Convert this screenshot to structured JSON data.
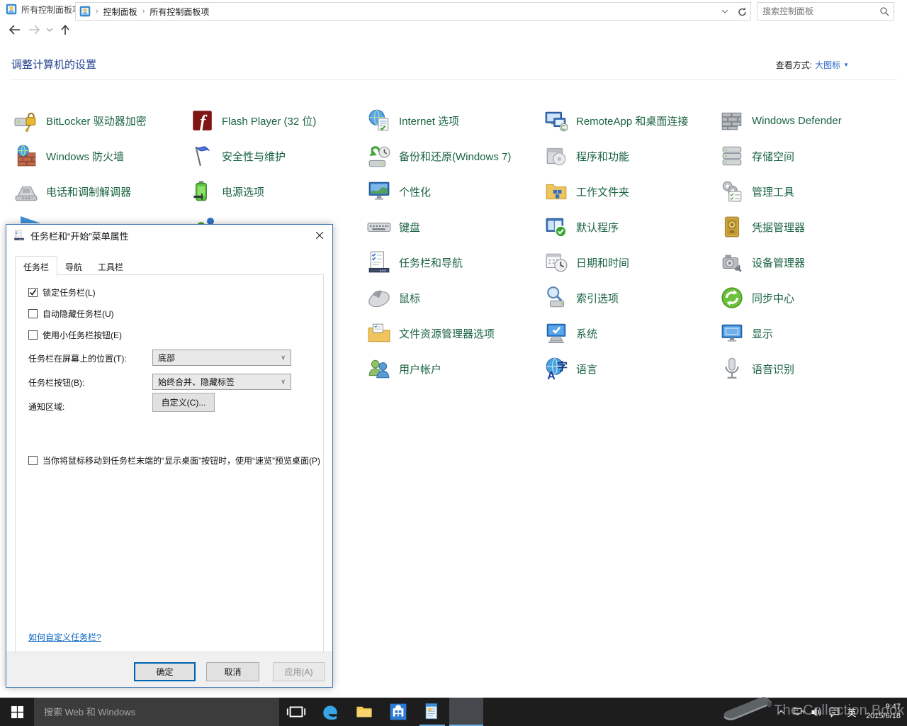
{
  "colors": {
    "accent": "#0078d7",
    "item_link": "#1a6340",
    "header_title": "#23418f",
    "link": "#0563c1",
    "taskbar_underline": "#6aaede"
  },
  "window": {
    "title": "所有控制面板项"
  },
  "toolbar": {
    "breadcrumb": [
      "控制面板",
      "所有控制面板项"
    ],
    "search_placeholder": "搜索控制面板"
  },
  "header": {
    "title": "调整计算机的设置",
    "view_label": "查看方式:",
    "view_value": "大图标"
  },
  "grid": {
    "items": [
      {
        "label": "BitLocker 驱动器加密",
        "icon": "bitlocker",
        "col": 0,
        "row": 0
      },
      {
        "label": "Windows 防火墙",
        "icon": "firewall",
        "col": 0,
        "row": 1
      },
      {
        "label": "电话和调制解调器",
        "icon": "phone",
        "col": 0,
        "row": 2
      },
      {
        "label": "Flash Player (32 位)",
        "icon": "flash",
        "col": 1,
        "row": 0
      },
      {
        "label": "安全性与维护",
        "icon": "security-flag",
        "col": 1,
        "row": 1
      },
      {
        "label": "电源选项",
        "icon": "power",
        "col": 1,
        "row": 2
      },
      {
        "label": "Internet 选项",
        "icon": "internet",
        "col": 2,
        "row": 0
      },
      {
        "label": "备份和还原(Windows 7)",
        "icon": "backup",
        "col": 2,
        "row": 1
      },
      {
        "label": "个性化",
        "icon": "personalization",
        "col": 2,
        "row": 2
      },
      {
        "label": "键盘",
        "icon": "keyboard",
        "col": 2,
        "row": 3
      },
      {
        "label": "任务栏和导航",
        "icon": "taskbar-nav",
        "col": 2,
        "row": 4
      },
      {
        "label": "鼠标",
        "icon": "mouse",
        "col": 2,
        "row": 5
      },
      {
        "label": "文件资源管理器选项",
        "icon": "explorer-options",
        "col": 2,
        "row": 6
      },
      {
        "label": "用户帐户",
        "icon": "user-accounts",
        "col": 2,
        "row": 7
      },
      {
        "label": "RemoteApp 和桌面连接",
        "icon": "remoteapp",
        "col": 3,
        "row": 0
      },
      {
        "label": "程序和功能",
        "icon": "programs",
        "col": 3,
        "row": 1
      },
      {
        "label": "工作文件夹",
        "icon": "work-folders",
        "col": 3,
        "row": 2
      },
      {
        "label": "默认程序",
        "icon": "default-programs",
        "col": 3,
        "row": 3
      },
      {
        "label": "日期和时间",
        "icon": "datetime",
        "col": 3,
        "row": 4
      },
      {
        "label": "索引选项",
        "icon": "indexing",
        "col": 3,
        "row": 5
      },
      {
        "label": "系统",
        "icon": "system",
        "col": 3,
        "row": 6
      },
      {
        "label": "语言",
        "icon": "language",
        "col": 3,
        "row": 7
      },
      {
        "label": "Windows Defender",
        "icon": "defender",
        "col": 4,
        "row": 0
      },
      {
        "label": "存储空间",
        "icon": "storage",
        "col": 4,
        "row": 1
      },
      {
        "label": "管理工具",
        "icon": "admin-tools",
        "col": 4,
        "row": 2
      },
      {
        "label": "凭据管理器",
        "icon": "credentials",
        "col": 4,
        "row": 3
      },
      {
        "label": "设备管理器",
        "icon": "device-manager",
        "col": 4,
        "row": 4
      },
      {
        "label": "同步中心",
        "icon": "sync",
        "col": 4,
        "row": 5
      },
      {
        "label": "显示",
        "icon": "display",
        "col": 4,
        "row": 6
      },
      {
        "label": "语音识别",
        "icon": "speech",
        "col": 4,
        "row": 7
      }
    ]
  },
  "dialog": {
    "title": "任务栏和“开始”菜单属性",
    "tabs": [
      "任务栏",
      "导航",
      "工具栏"
    ],
    "active_tab_index": 0,
    "checkboxes": [
      {
        "label": "锁定任务栏(L)",
        "checked": true
      },
      {
        "label": "自动隐藏任务栏(U)",
        "checked": false
      },
      {
        "label": "使用小任务栏按钮(E)",
        "checked": false
      }
    ],
    "fields": [
      {
        "label": "任务栏在屏幕上的位置(T):",
        "value": "底部"
      },
      {
        "label": "任务栏按钮(B):",
        "value": "始终合并、隐藏标签"
      }
    ],
    "notification_label": "通知区域:",
    "customize_button": "自定义(C)...",
    "peek_checkbox": {
      "label": "当你将鼠标移动到任务栏末端的“显示桌面”按钮时，使用“速览”预览桌面(P)",
      "checked": false
    },
    "help_link": "如何自定义任务栏?",
    "buttons": {
      "ok": "确定",
      "cancel": "取消",
      "apply": "应用(A)"
    }
  },
  "taskbar": {
    "search_placeholder": "搜索 Web 和 Windows",
    "buttons": [
      {
        "icon": "taskview",
        "name": "task-view-button",
        "running": false,
        "active": false
      },
      {
        "icon": "edge",
        "name": "edge-button",
        "running": false,
        "active": false
      },
      {
        "icon": "folder",
        "name": "file-explorer-button",
        "running": false,
        "active": false
      },
      {
        "icon": "store",
        "name": "store-button",
        "running": false,
        "active": false
      },
      {
        "icon": "cp-window",
        "name": "control-panel-task-button",
        "running": true,
        "active": false
      },
      {
        "icon": "taskbar-props",
        "name": "taskbar-properties-task-button",
        "running": true,
        "active": true
      }
    ],
    "tray_icons": [
      {
        "icon": "chevron-up",
        "name": "hidden-icons-chevron"
      },
      {
        "icon": "network",
        "name": "network-icon"
      },
      {
        "icon": "speaker",
        "name": "volume-icon"
      },
      {
        "icon": "action-center",
        "name": "action-center-icon"
      }
    ],
    "input_indicator": "英",
    "time": "9:47",
    "date": "2015/6/18"
  },
  "watermark": {
    "text": "The Collection Book"
  }
}
